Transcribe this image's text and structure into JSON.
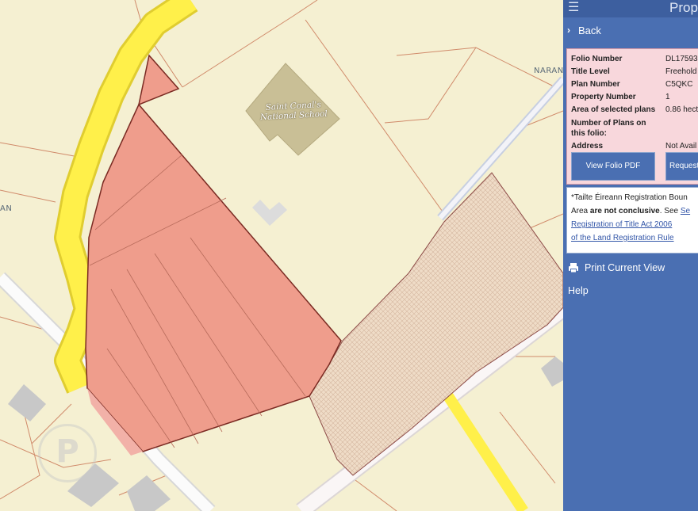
{
  "map": {
    "school_label_line1": "Saint Conal's",
    "school_label_line2": "National School",
    "left_road_label": "AN",
    "right_road_label": "NARAN",
    "watermark_glyph": "P",
    "colors": {
      "background": "#f5f0d2",
      "selected_plot": "#ef9d8c",
      "plot_outline": "#7a2a22",
      "main_road": "#fff04a",
      "school_building": "#c9bf96",
      "hatched_plot": "#efdcc7"
    }
  },
  "panel": {
    "menu_icon": "hamburger-icon",
    "title": "Prop",
    "back_label": "Back",
    "folio": {
      "rows": [
        {
          "key": "Folio Number",
          "value": "DL17593"
        },
        {
          "key": "Title Level",
          "value": "Freehold"
        },
        {
          "key": "Plan Number",
          "value": "C5QKC"
        },
        {
          "key": "Property Number",
          "value": "1"
        },
        {
          "key": "Area of selected plans",
          "value": "0.86 hect"
        },
        {
          "key": "Number of Plans on this folio:",
          "value": ""
        },
        {
          "key": "Address",
          "value": "Not Avail"
        }
      ],
      "view_button": "View Folio PDF",
      "request_button": "Request"
    },
    "notice": {
      "line1": "*Tailte Éireann Registration Boun",
      "line2_prefix": "Area ",
      "line2_bold": "are not conclusive",
      "line2_suffix": ". See ",
      "line2_link": "Se",
      "line3_link": "Registration of Title Act 2006",
      "line4_link": "of the Land Registration Rule"
    },
    "print_label": "Print Current View",
    "help_label": "Help",
    "colors": {
      "panel": "#4a6fb2",
      "info_box": "#f8d7dc"
    }
  }
}
